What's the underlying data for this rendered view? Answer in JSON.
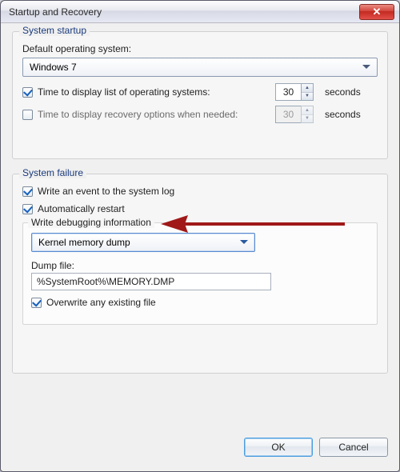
{
  "title": "Startup and Recovery",
  "startup": {
    "legend": "System startup",
    "default_os_label": "Default operating system:",
    "default_os_value": "Windows 7",
    "display_list_label": "Time to display list of operating systems:",
    "display_list_checked": true,
    "display_list_value": "30",
    "display_recovery_label": "Time to display recovery options when needed:",
    "display_recovery_checked": false,
    "display_recovery_value": "30",
    "seconds_unit": "seconds"
  },
  "failure": {
    "legend": "System failure",
    "write_event_label": "Write an event to the system log",
    "write_event_checked": true,
    "auto_restart_label": "Automatically restart",
    "auto_restart_checked": true,
    "debug_legend": "Write debugging information",
    "dump_type_value": "Kernel memory dump",
    "dump_file_label": "Dump file:",
    "dump_file_value": "%SystemRoot%\\MEMORY.DMP",
    "overwrite_label": "Overwrite any existing file",
    "overwrite_checked": true
  },
  "buttons": {
    "ok": "OK",
    "cancel": "Cancel"
  },
  "annotation": {
    "arrow_color": "#a01818"
  }
}
